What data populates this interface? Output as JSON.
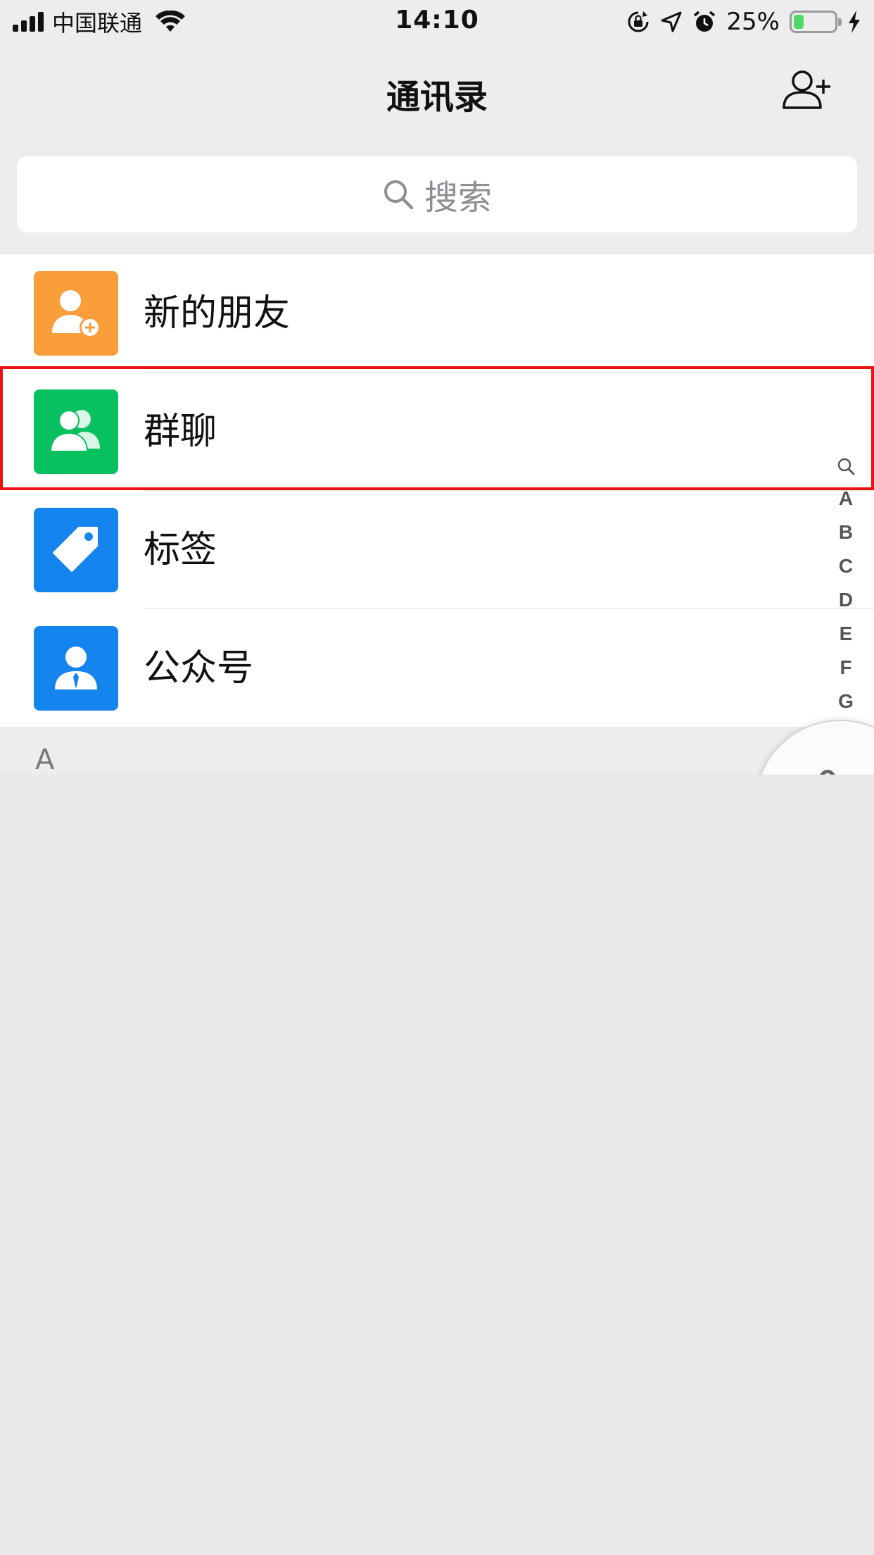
{
  "status_bar": {
    "carrier": "中国联通",
    "time": "14:10",
    "battery_percent": "25%",
    "battery_level": 0.25
  },
  "nav": {
    "title": "通讯录",
    "add_contact_icon": "add-contact-icon"
  },
  "search": {
    "placeholder": "搜索"
  },
  "functions": [
    {
      "label": "新的朋友",
      "icon": "new-friend-icon",
      "color": "#fa9d3b"
    },
    {
      "label": "群聊",
      "icon": "group-chat-icon",
      "color": "#07c160"
    },
    {
      "label": "标签",
      "icon": "tag-icon",
      "color": "#1485ee"
    },
    {
      "label": "公众号",
      "icon": "official-account-icon",
      "color": "#1485ee"
    }
  ],
  "section": {
    "letter": "A"
  },
  "index_letters": [
    "A",
    "B",
    "C",
    "D",
    "E",
    "F",
    "G"
  ],
  "colors": {
    "highlight": "#ee1111",
    "background": "#ededed"
  }
}
